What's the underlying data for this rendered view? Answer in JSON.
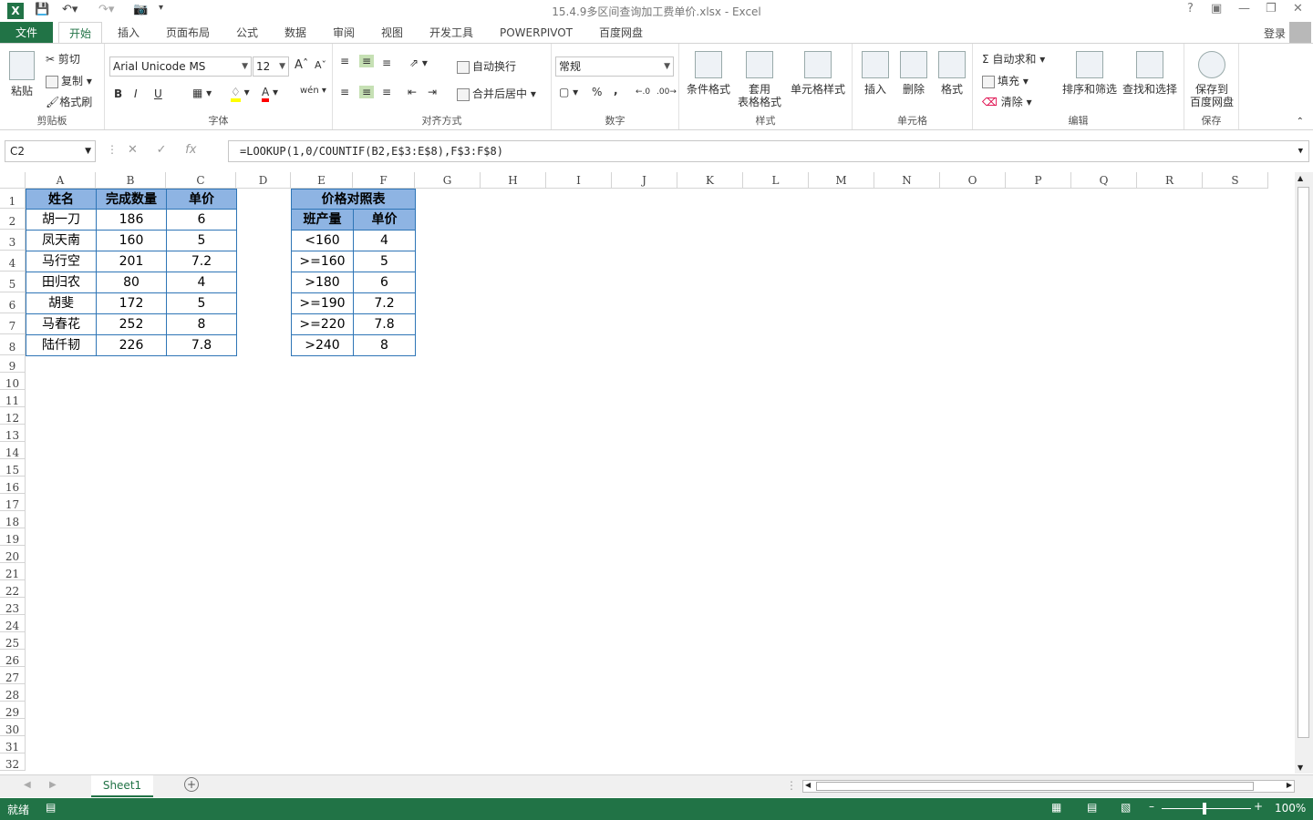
{
  "window": {
    "title": "15.4.9多区间查询加工费单价.xlsx - Excel",
    "login_label": "登录"
  },
  "tabs": [
    {
      "label": "文件"
    },
    {
      "label": "开始"
    },
    {
      "label": "插入"
    },
    {
      "label": "页面布局"
    },
    {
      "label": "公式"
    },
    {
      "label": "数据"
    },
    {
      "label": "审阅"
    },
    {
      "label": "视图"
    },
    {
      "label": "开发工具"
    },
    {
      "label": "POWERPIVOT"
    },
    {
      "label": "百度网盘"
    }
  ],
  "ribbon": {
    "clipboard": {
      "label": "剪贴板",
      "paste": "粘贴",
      "cut": "剪切",
      "copy": "复制",
      "format_painter": "格式刷"
    },
    "font": {
      "label": "字体",
      "font_name": "Arial Unicode MS",
      "font_size": "12",
      "bold": "B",
      "italic": "I",
      "underline": "U"
    },
    "alignment": {
      "label": "对齐方式",
      "wrap": "自动换行",
      "merge": "合并后居中"
    },
    "number": {
      "label": "数字",
      "format": "常规",
      "percent": "%",
      "comma": ","
    },
    "styles": {
      "label": "样式",
      "conditional": "条件格式",
      "table_format_1": "套用",
      "table_format_2": "表格格式",
      "cell_styles": "单元格样式"
    },
    "cells": {
      "label": "单元格",
      "insert": "插入",
      "delete": "删除",
      "format": "格式"
    },
    "editing": {
      "label": "编辑",
      "autosum": "自动求和",
      "fill": "填充",
      "clear": "清除",
      "sort": "排序和筛选",
      "find": "查找和选择"
    },
    "save": {
      "label": "保存",
      "save_1": "保存到",
      "save_2": "百度网盘"
    }
  },
  "formula_bar": {
    "name_box": "C2",
    "formula": "=LOOKUP(1,0/COUNTIF(B2,E$3:E$8),F$3:F$8)"
  },
  "columns": [
    "A",
    "B",
    "C",
    "D",
    "E",
    "F",
    "G",
    "H",
    "I",
    "J",
    "K",
    "L",
    "M",
    "N",
    "O",
    "P",
    "Q",
    "R",
    "S"
  ],
  "rows": [
    "1",
    "2",
    "3",
    "4",
    "5",
    "6",
    "7",
    "8",
    "9",
    "10",
    "11",
    "12",
    "13",
    "14",
    "15",
    "16",
    "17",
    "18",
    "19",
    "20",
    "21",
    "22",
    "23",
    "24",
    "25",
    "26",
    "27",
    "28",
    "29",
    "30",
    "31",
    "32"
  ],
  "left_table": {
    "headers": [
      "姓名",
      "完成数量",
      "单价"
    ],
    "rows": [
      [
        "胡一刀",
        "186",
        "6"
      ],
      [
        "凤天南",
        "160",
        "5"
      ],
      [
        "马行空",
        "201",
        "7.2"
      ],
      [
        "田归农",
        "80",
        "4"
      ],
      [
        "胡斐",
        "172",
        "5"
      ],
      [
        "马春花",
        "252",
        "8"
      ],
      [
        "陆仟韧",
        "226",
        "7.8"
      ]
    ]
  },
  "right_table": {
    "title": "价格对照表",
    "headers": [
      "班产量",
      "单价"
    ],
    "rows": [
      [
        "<160",
        "4"
      ],
      [
        ">=160",
        "5"
      ],
      [
        ">180",
        "6"
      ],
      [
        ">=190",
        "7.2"
      ],
      [
        ">=220",
        "7.8"
      ],
      [
        ">240",
        "8"
      ]
    ]
  },
  "sheet_tab": "Sheet1",
  "status": {
    "ready": "就绪",
    "zoom": "100%"
  }
}
